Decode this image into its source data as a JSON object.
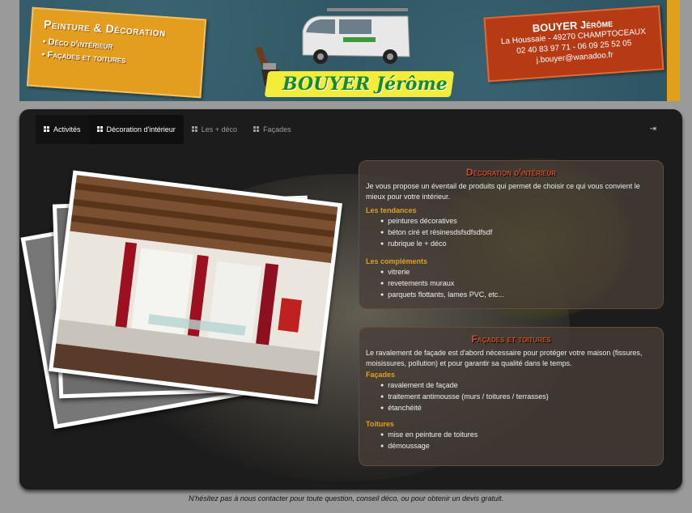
{
  "banner": {
    "left_card": {
      "title": "Peinture & Décoration",
      "items": [
        "Déco d'intérieur",
        "Façades et toitures"
      ]
    },
    "logo": "BOUYER Jérôme",
    "right_card": {
      "name": "BOUYER Jérôme",
      "address": "La Houssaie - 49270 CHAMPTOCEAUX",
      "phones": "02 40 83 97 71 - 06 09 25 52 05",
      "email": "j.bouyer@wanadoo.fr"
    },
    "colors": {
      "orange": "#e39e1f",
      "red": "#b63b14",
      "teal": "#2f5663",
      "logo_yellow": "#f4ec3a",
      "logo_green": "#168a2e"
    }
  },
  "nav": {
    "items": [
      {
        "label": "Activités",
        "icon": "grid-icon"
      },
      {
        "label": "Décoration d'intérieur",
        "icon": "grid-icon"
      },
      {
        "label": "Les + déco",
        "icon": "grid-icon"
      },
      {
        "label": "Façades",
        "icon": "grid-icon"
      }
    ],
    "login_icon": "sign-in-icon"
  },
  "deco": {
    "title": "Décoration d'intérieur",
    "intro": "Je vous propose un éventail de produits qui permet de choisir ce qui vous convient le mieux pour votre intérieur.",
    "sections": [
      {
        "title": "Les tendances",
        "items": [
          "peintures décoratives",
          "béton ciré et résinesdsfsdfsdfsdf",
          "rubrique le + déco"
        ]
      },
      {
        "title": "Les compléments",
        "items": [
          "vitrerie",
          "revetements muraux",
          "parquets flottants, lames PVC, etc..."
        ]
      }
    ]
  },
  "facades": {
    "title": "Façades et toitures",
    "intro": "Le ravalement de façade est d'abord nécessaire pour protéger votre maison (fissures, moisissures, pollution) et pour garantir sa qualité dans le temps.",
    "sections": [
      {
        "title": "Façades",
        "items": [
          "ravalement de façade",
          "traitement antimousse (murs / toitures / terrasses)",
          "étanchéité"
        ]
      },
      {
        "title": "Toitures",
        "items": [
          "mise en peinture de toitures",
          "démoussage"
        ]
      }
    ]
  },
  "footer": "N'hésitez pas à nous contacter pour toute question, conseil déco, ou pour obtenir un devis gratuit."
}
